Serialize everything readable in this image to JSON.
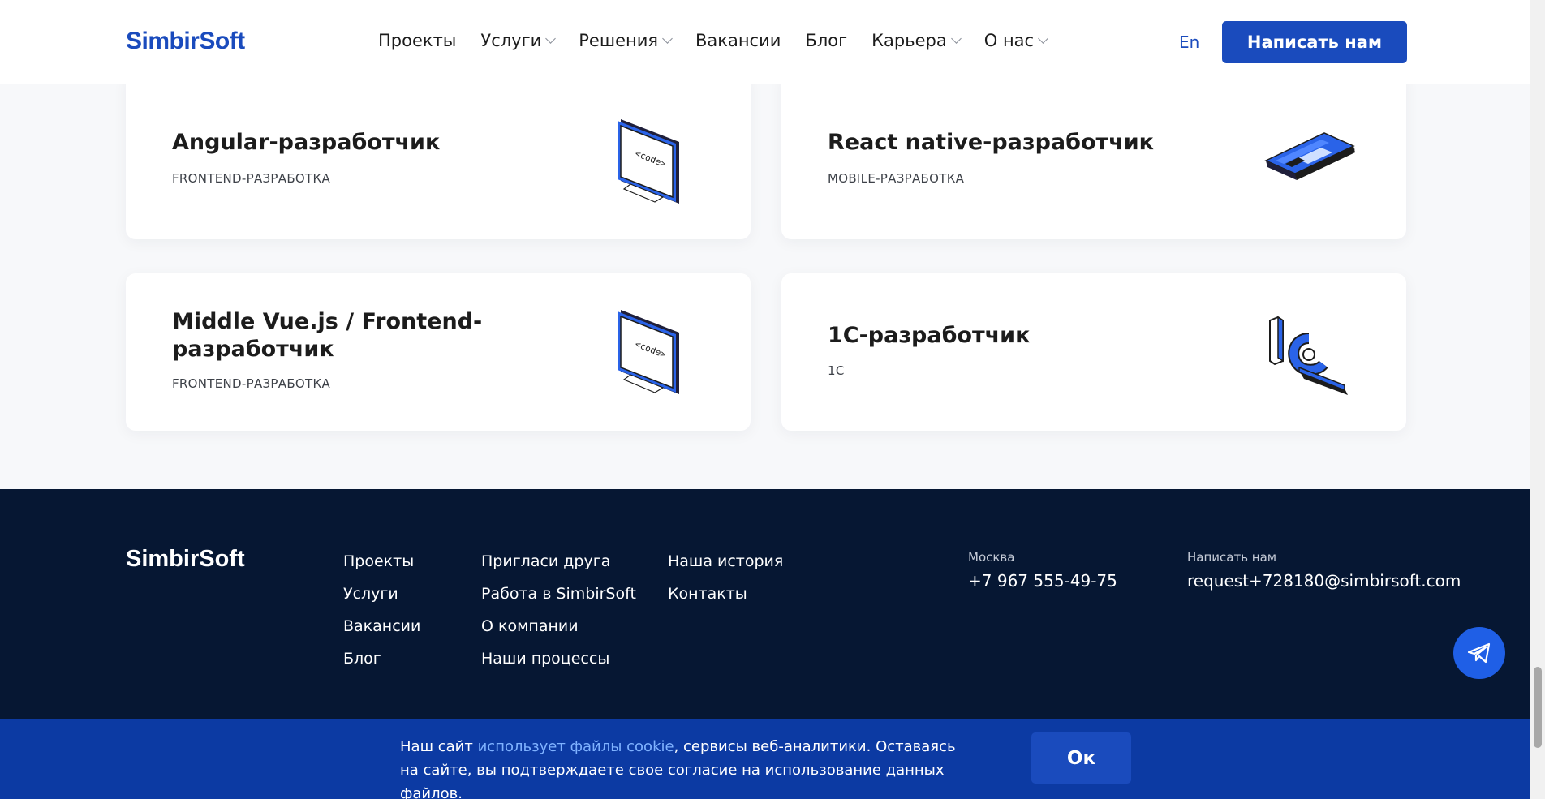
{
  "header": {
    "logo": "SimbirSoft",
    "nav": [
      {
        "label": "Проекты",
        "dropdown": false
      },
      {
        "label": "Услуги",
        "dropdown": true
      },
      {
        "label": "Решения",
        "dropdown": true
      },
      {
        "label": "Вакансии",
        "dropdown": false
      },
      {
        "label": "Блог",
        "dropdown": false
      },
      {
        "label": "Карьера",
        "dropdown": true
      },
      {
        "label": "О нас",
        "dropdown": true
      }
    ],
    "lang": "En",
    "cta": "Написать нам"
  },
  "cards": [
    {
      "title": "Angular-разработчик",
      "category": "FRONTEND-РАЗРАБОТКА",
      "icon": "monitor-code-icon"
    },
    {
      "title": "React native-разработчик",
      "category": "MOBILE-РАЗРАБОТКА",
      "icon": "smartphone-icon"
    },
    {
      "title": "Middle Vue.js / Frontend-разработчик",
      "category": "FRONTEND-РАЗРАБОТКА",
      "icon": "monitor-code-icon"
    },
    {
      "title": "1С-разработчик",
      "category": "1С",
      "icon": "1c-logo-icon"
    }
  ],
  "footer": {
    "logo": "SimbirSoft",
    "col1": [
      "Проекты",
      "Услуги",
      "Вакансии",
      "Блог"
    ],
    "col2": [
      "Пригласи друга",
      "Работа в SimbirSoft",
      "О компании",
      "Наши процессы"
    ],
    "col3": [
      "Наша история",
      "Контакты"
    ],
    "city_label": "Москва",
    "phone": "+7 967 555-49-75",
    "email_label": "Написать нам",
    "email": "request+728180@simbirsoft.com"
  },
  "cookie": {
    "text_before": "Наш сайт ",
    "link": "использует файлы cookie",
    "text_after": ", сервисы веб-аналитики. Оставаясь на сайте, вы подтверждаете свое согласие на использование данных файлов.",
    "ok": "Ок"
  },
  "colors": {
    "brand": "#1a4bbd",
    "footer_bg": "#061733",
    "cookie_bg": "#0c3aa3"
  }
}
